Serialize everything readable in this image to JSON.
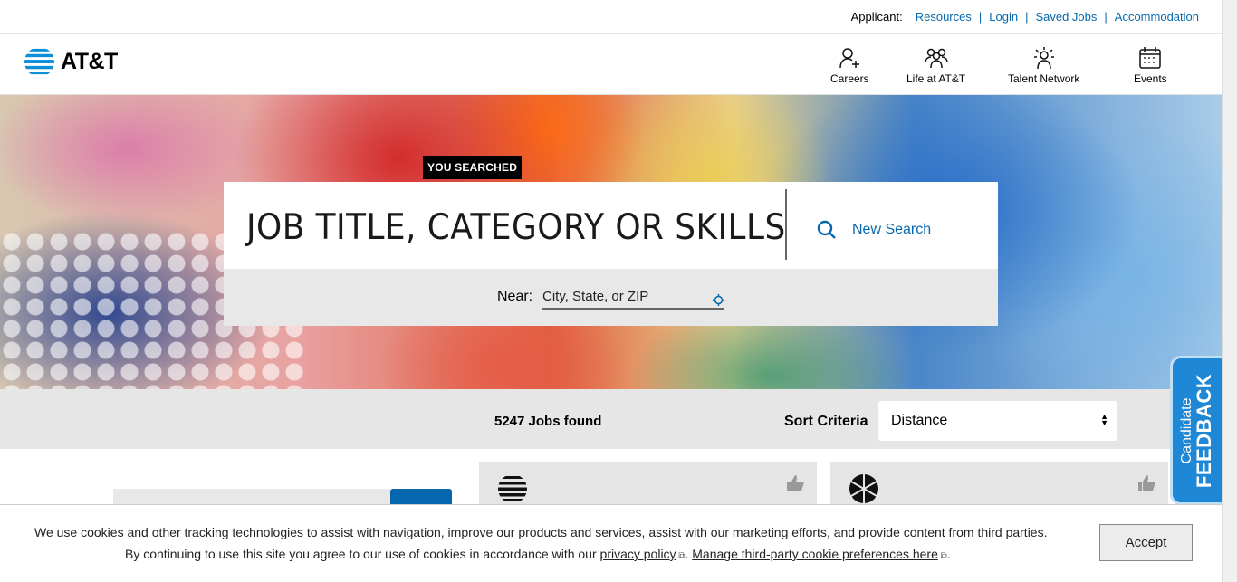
{
  "utility_bar": {
    "applicant_label": "Applicant:",
    "links": [
      "Resources",
      "Login",
      "Saved Jobs",
      "Accommodation"
    ],
    "separator": "|"
  },
  "header": {
    "brand": "AT&T",
    "nav": [
      {
        "label": "Careers",
        "icon": "person-add-icon"
      },
      {
        "label": "Life at AT&T",
        "icon": "people-group-icon"
      },
      {
        "label": "Talent Network",
        "icon": "network-person-icon"
      },
      {
        "label": "Events",
        "icon": "calendar-icon"
      }
    ]
  },
  "hero": {
    "you_searched": "YOU SEARCHED",
    "query": "JOB TITLE, CATEGORY OR SKILLS",
    "new_search": "New Search",
    "near_label": "Near:",
    "near_placeholder": "City, State, or ZIP"
  },
  "results": {
    "count": "5247 Jobs found",
    "sort_label": "Sort Criteria",
    "sort_value": "Distance"
  },
  "feedback": {
    "line1": "Candidate",
    "line2": "FEEDBACK"
  },
  "cookie": {
    "line1": "We use cookies and other tracking technologies to assist with navigation, improve our products and services, assist with our marketing efforts, and provide content from third parties.",
    "line2_prefix": "By continuing to use this site you agree to our use of cookies in accordance with our",
    "privacy_link": "privacy policy",
    "manage_link": "Manage third-party cookie preferences here",
    "accept": "Accept"
  },
  "colors": {
    "link_blue": "#0568ae",
    "feedback_blue": "#1e88d6"
  }
}
